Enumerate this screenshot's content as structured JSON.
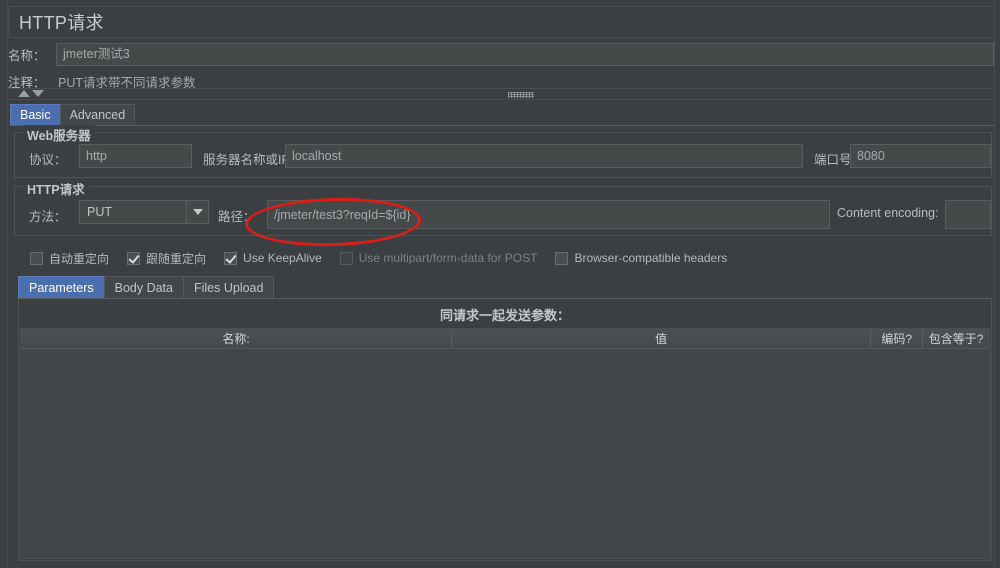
{
  "window": {
    "title": "HTTP请求"
  },
  "form": {
    "name_label": "名称：",
    "name_value": "jmeter测试3",
    "comment_label": "注释：",
    "comment_value": "PUT请求带不同请求参数"
  },
  "main_tabs": [
    {
      "label": "Basic",
      "active": true
    },
    {
      "label": "Advanced",
      "active": false
    }
  ],
  "web_server": {
    "group_title": "Web服务器",
    "protocol_label": "协议：",
    "protocol_value": "http",
    "host_label": "服务器名称或IP：",
    "host_value": "localhost",
    "port_label": "端口号：",
    "port_value": "8080"
  },
  "http_request": {
    "group_title": "HTTP请求",
    "method_label": "方法：",
    "method_value": "PUT",
    "method_arrow_icon": "chevron-down-icon",
    "path_label": "路径：",
    "path_value": "/jmeter/test3?reqId=${id}",
    "content_encoding_label": "Content encoding:",
    "content_encoding_value": ""
  },
  "options": [
    {
      "label": "自动重定向",
      "checked": false,
      "disabled": false
    },
    {
      "label": "跟随重定向",
      "checked": true,
      "disabled": false
    },
    {
      "label": "Use KeepAlive",
      "checked": true,
      "disabled": false
    },
    {
      "label": "Use multipart/form-data for POST",
      "checked": false,
      "disabled": true
    },
    {
      "label": "Browser-compatible headers",
      "checked": false,
      "disabled": false
    }
  ],
  "sub_tabs": [
    {
      "label": "Parameters",
      "active": true
    },
    {
      "label": "Body Data",
      "active": false
    },
    {
      "label": "Files Upload",
      "active": false
    }
  ],
  "parameters": {
    "heading": "同请求一起发送参数：",
    "columns": [
      "名称:",
      "值",
      "编码?",
      "包含等于?"
    ],
    "rows": []
  },
  "splitter": {
    "collapse_up_icon": "triangle-up-icon",
    "collapse_down_icon": "triangle-down-icon",
    "grip_icon": "splitter-grip-icon"
  },
  "annotation": {
    "shape": "ellipse",
    "color": "#d91f18",
    "targets": "http_request.path_value"
  },
  "colors": {
    "background": "#3c3f41",
    "field_background": "#45494a",
    "tab_active": "#4b6eaf",
    "text": "#b0b3b8",
    "annotation_red": "#d91f18"
  }
}
